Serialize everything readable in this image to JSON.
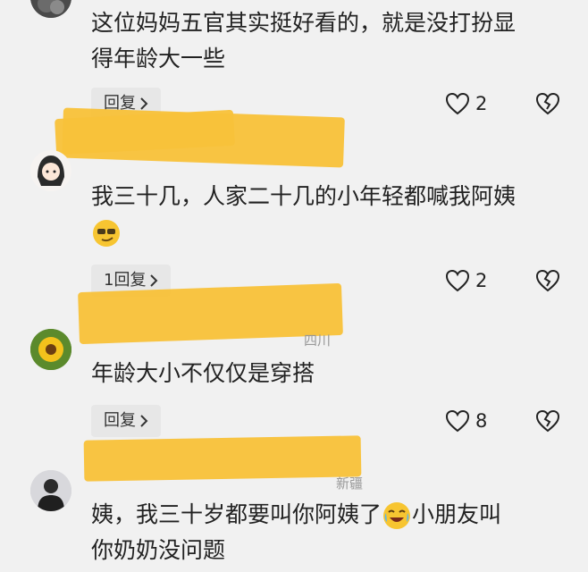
{
  "comments": [
    {
      "text_lines": [
        "这位妈妈五官其实挺好看的，就是没打扮显",
        "得年龄大一些"
      ],
      "reply_label": "回复",
      "likes": "2"
    },
    {
      "meta": "",
      "text_lines": [
        "我三十几，人家二十几的小年轻都喊我阿姨"
      ],
      "emoji": "smirk-sunglasses-emoji",
      "reply_label": "1回复",
      "likes": "2"
    },
    {
      "meta": "四川",
      "text_lines": [
        "年龄大小不仅仅是穿搭"
      ],
      "reply_label": "回复",
      "likes": "8"
    },
    {
      "meta": "新疆",
      "text_lines": [
        "姨，我三十岁都要叫你阿姨了",
        "小朋友叫",
        "你奶奶没问题"
      ],
      "emoji": "laugh-cry-emoji"
    }
  ],
  "icons": {
    "chevron": "chevron-right-icon",
    "heart": "heart-icon",
    "broken_heart": "broken-heart-icon"
  },
  "colors": {
    "background": "#f1f1f1",
    "highlight": "#f8c23a",
    "reply_bg": "#e7e7e7"
  }
}
